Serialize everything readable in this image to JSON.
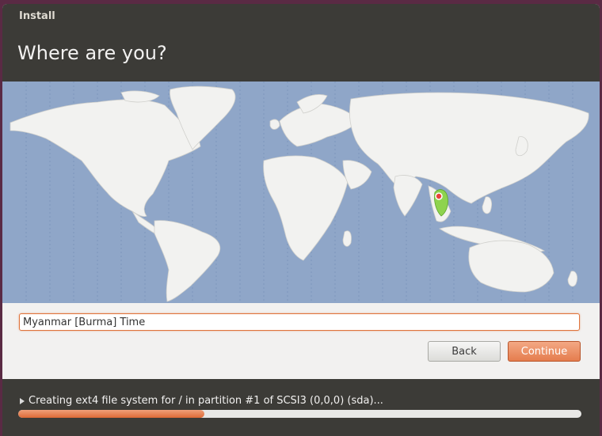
{
  "window": {
    "title": "Install"
  },
  "page": {
    "title": "Where are you?"
  },
  "map": {
    "selected_marker_color": "#e8443a",
    "land_color": "#f2f2f0",
    "water_color": "#8fa6c8",
    "highlight_color": "#8ed34e"
  },
  "timezone": {
    "value": "Myanmar [Burma] Time"
  },
  "buttons": {
    "back": "Back",
    "continue": "Continue"
  },
  "status": {
    "text": "Creating ext4 file system for / in partition #1 of SCSI3 (0,0,0) (sda)...",
    "progress": 0.33
  },
  "colors": {
    "accent": "#e57d4e",
    "header": "#3c3b37"
  }
}
